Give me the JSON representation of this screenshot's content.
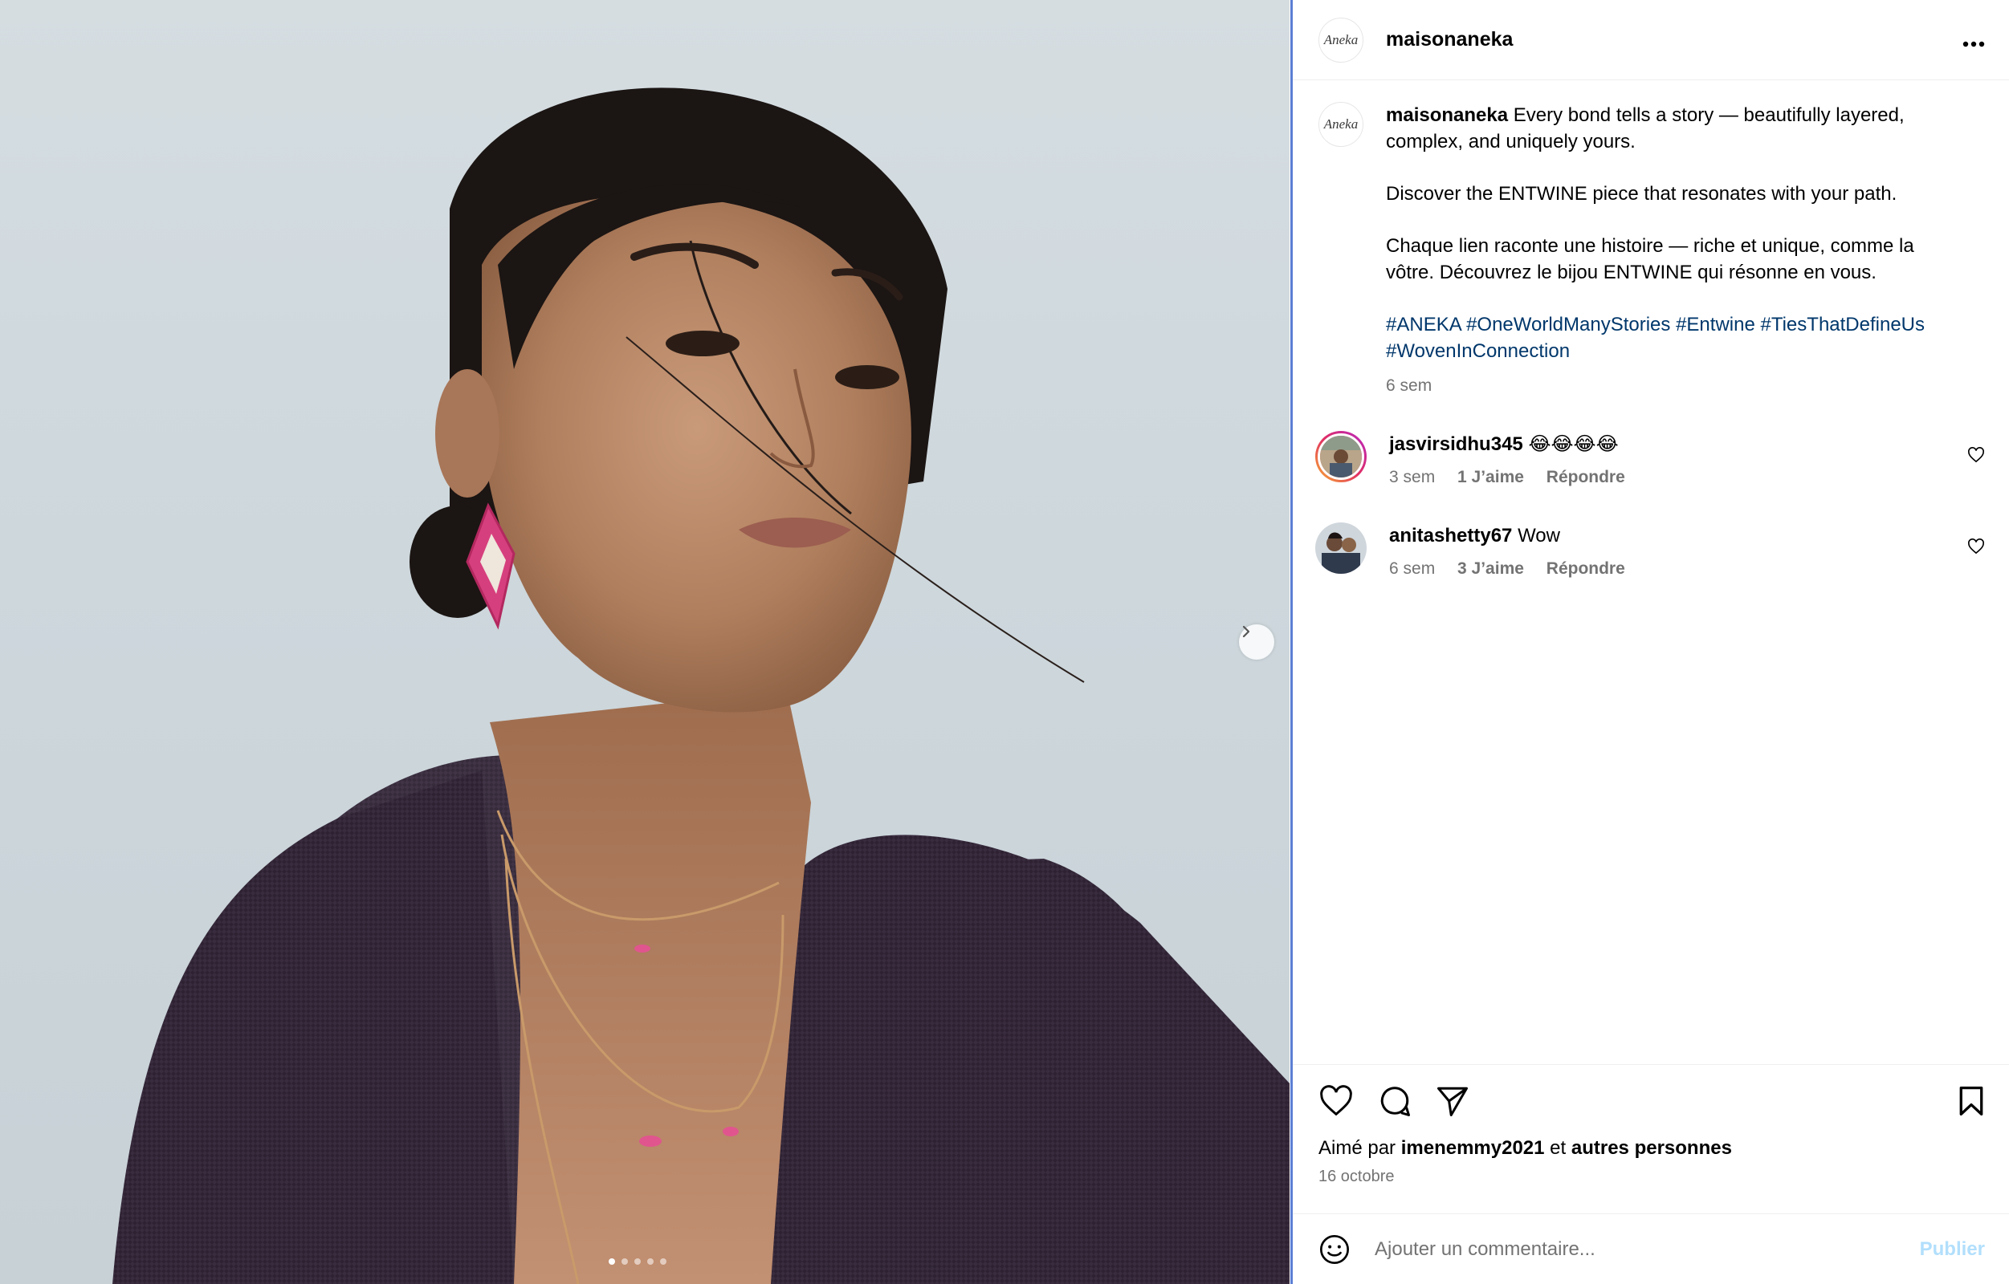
{
  "header": {
    "username": "maisonaneka",
    "logo_text": "Aneka",
    "more_label": "..."
  },
  "caption": {
    "username": "maisonaneka",
    "line1": "Every bond tells a story — beautifully layered, complex, and uniquely yours.",
    "line2": "Discover the ENTWINE piece that resonates with your path.",
    "line3": "Chaque lien raconte une histoire — riche et unique, comme la vôtre. Découvrez le bijou ENTWINE qui résonne en vous.",
    "hashtags": [
      "#ANEKA",
      "#OneWorldManyStories",
      "#Entwine",
      "#TiesThatDefineUs",
      "#WovenInConnection"
    ],
    "time": "6 sem"
  },
  "comments": [
    {
      "username": "jasvirsidhu345",
      "text": "😂😂😂😂",
      "time": "3 sem",
      "likes": "1 J’aime",
      "reply": "Répondre"
    },
    {
      "username": "anitashetty67",
      "text": "Wow",
      "time": "6 sem",
      "likes": "3 J’aime",
      "reply": "Répondre"
    }
  ],
  "likes": {
    "prefix": "Aimé par",
    "user": "imenemmy2021",
    "joiner": "et",
    "others": "autres personnes"
  },
  "date": "16 octobre",
  "add_comment": {
    "placeholder": "Ajouter un commentaire...",
    "post_label": "Publier"
  },
  "carousel": {
    "total": 5,
    "active": 1
  },
  "colors": {
    "hashtag": "#00376b",
    "muted": "#737373",
    "post_button": "#b2dffc",
    "panel_border": "#5b7fd4"
  }
}
